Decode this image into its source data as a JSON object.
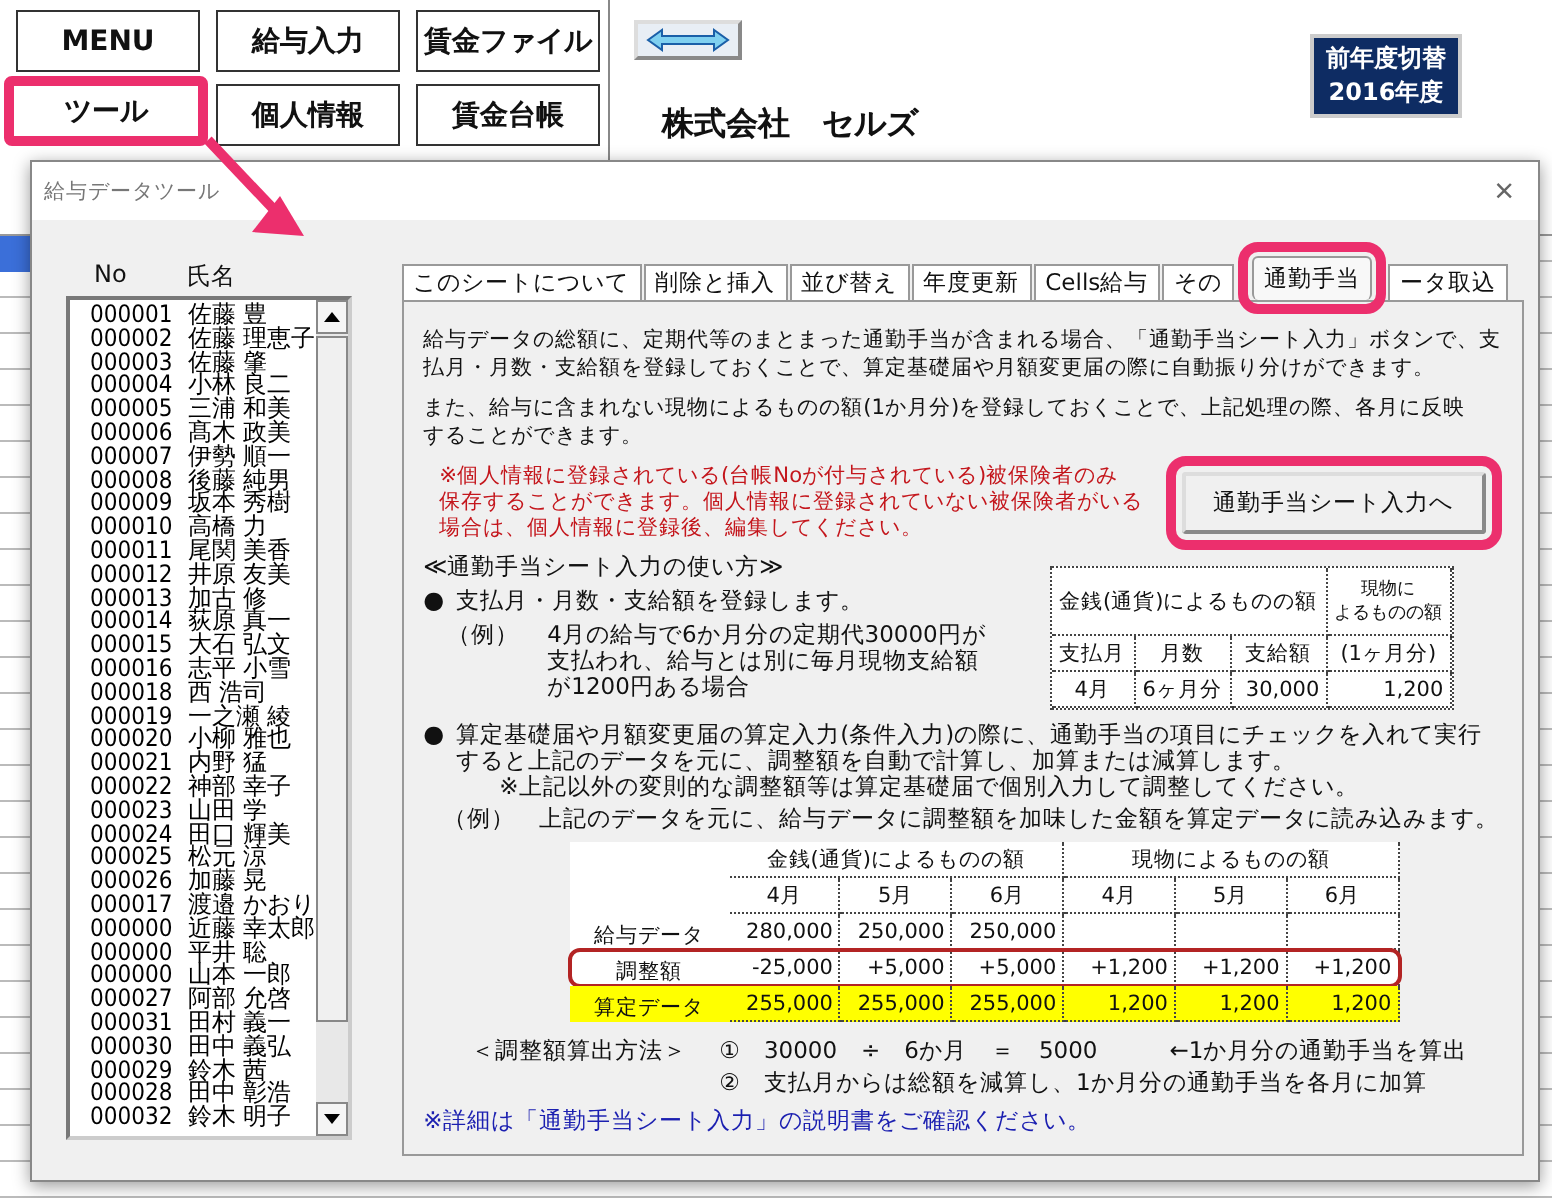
{
  "menu_buttons": [
    {
      "label": "MENU",
      "selected": false
    },
    {
      "label": "給与入力",
      "selected": false
    },
    {
      "label": "賃金ファイル",
      "selected": false
    },
    {
      "label": "ツール",
      "selected": true
    },
    {
      "label": "個人情報",
      "selected": false
    },
    {
      "label": "賃金台帳",
      "selected": false
    }
  ],
  "company": "株式会社　セルズ",
  "year_badge": [
    "前年度切替",
    "2016年度"
  ],
  "dialog": {
    "title": "給与データツール",
    "close": "×",
    "list_headers": [
      "No",
      "氏名"
    ],
    "employees": [
      {
        "no": "000001",
        "name": "佐藤 豊"
      },
      {
        "no": "000002",
        "name": "佐藤 理恵子"
      },
      {
        "no": "000003",
        "name": "佐藤 肇"
      },
      {
        "no": "000004",
        "name": "小林 良二"
      },
      {
        "no": "000005",
        "name": "三浦 和美"
      },
      {
        "no": "000006",
        "name": "髙木 政美"
      },
      {
        "no": "000007",
        "name": "伊勢 順一"
      },
      {
        "no": "000008",
        "name": "後藤 純男"
      },
      {
        "no": "000009",
        "name": "坂本 秀樹"
      },
      {
        "no": "000010",
        "name": "高橋 力"
      },
      {
        "no": "000011",
        "name": "尾関 美香"
      },
      {
        "no": "000012",
        "name": "井原 友美"
      },
      {
        "no": "000013",
        "name": "加古 修"
      },
      {
        "no": "000014",
        "name": "荻原 真一"
      },
      {
        "no": "000015",
        "name": "大石 弘文"
      },
      {
        "no": "000016",
        "name": "志平 小雪"
      },
      {
        "no": "000018",
        "name": "西 浩司"
      },
      {
        "no": "000019",
        "name": "一之瀬 綾"
      },
      {
        "no": "000020",
        "name": "小柳 雅也"
      },
      {
        "no": "000021",
        "name": "内野 猛"
      },
      {
        "no": "000022",
        "name": "神部 幸子"
      },
      {
        "no": "000023",
        "name": "山田 学"
      },
      {
        "no": "000024",
        "name": "田口 輝美"
      },
      {
        "no": "000025",
        "name": "松元 涼"
      },
      {
        "no": "000026",
        "name": "加藤 晃"
      },
      {
        "no": "000017",
        "name": "渡邉 かおり"
      },
      {
        "no": "000000",
        "name": "近藤 幸太郎"
      },
      {
        "no": "000000",
        "name": "平井 聡"
      },
      {
        "no": "000000",
        "name": "山本 一郎"
      },
      {
        "no": "000027",
        "name": "阿部 允啓"
      },
      {
        "no": "000031",
        "name": "田村 義一"
      },
      {
        "no": "000030",
        "name": "田中 義弘"
      },
      {
        "no": "000029",
        "name": "鈴木 茜"
      },
      {
        "no": "000028",
        "name": "田中 彰浩"
      },
      {
        "no": "000032",
        "name": "鈴木 明子"
      }
    ],
    "tabs": [
      {
        "label": "このシートについて",
        "selected": false
      },
      {
        "label": "削除と挿入",
        "selected": false
      },
      {
        "label": "並び替え",
        "selected": false
      },
      {
        "label": "年度更新",
        "selected": false
      },
      {
        "label": "Cells給与",
        "selected": false
      },
      {
        "label": "その",
        "selected": false
      },
      {
        "label": "通勤手当",
        "selected": true
      },
      {
        "label": "ータ取込",
        "selected": false
      }
    ],
    "intro": [
      [
        "給与データの総額に、定期代等のまとまった通勤手当が含まれる場合、「通勤手当シート入力」ボタンで、支",
        "払月・月数・支給額を登録しておくことで、算定基礎届や月額変更届の際に自動振り分けができます。"
      ],
      [
        "また、給与に含まれない現物によるものの額(1か月分)を登録しておくことで、上記処理の際、各月に反映",
        "することができます。"
      ]
    ],
    "note": [
      "※個人情報に登録されている(台帳Noが付与されている)被保険者のみ",
      "保存することができます。個人情報に登録されていない被保険者がいる",
      "場合は、個人情報に登録後、編集してください。"
    ],
    "input_button": {
      "label": "通勤手当シート入力へ",
      "highlighted": true
    },
    "howto_title": "≪通勤手当シート入力の使い方≫",
    "bullet": "●",
    "step1": "支払月・月数・支給額を登録します。",
    "example1_label": "（例）",
    "example1": [
      "4月の給与で6か月分の定期代30000円が",
      "支払われ、給与とは別に毎月現物支給額",
      "が1200円ある場合"
    ],
    "small_table": {
      "group_cash": "金銭(通貨)によるものの額",
      "group_kind": [
        "現物に",
        "よるものの額"
      ],
      "headers": [
        "支払月",
        "月数",
        "支給額",
        "(1ヶ月分)"
      ],
      "values": [
        "4月",
        "6ヶ月分",
        "30,000",
        "1,200"
      ]
    },
    "step2": [
      "算定基礎届や月額変更届の算定入力(条件入力)の際に、通勤手当の項目にチェックを入れて実行",
      "すると上記のデータを元に、調整額を自動で計算し、加算または減算します。"
    ],
    "step2_note": "※上記以外の変則的な調整額等は算定基礎届で個別入力して調整してください。",
    "example2_label": "（例）",
    "example2": "上記のデータを元に、給与データに調整額を加味した金額を算定データに読み込みます。",
    "calc_table": {
      "group_cash": "金銭(通貨)によるものの額",
      "group_kind": "現物によるものの額",
      "months": [
        "4月",
        "5月",
        "6月",
        "4月",
        "5月",
        "6月"
      ],
      "rows": [
        {
          "label": "給与データ",
          "kind": "plain",
          "highlighted": false,
          "values": [
            "280,000",
            "250,000",
            "250,000"
          ]
        },
        {
          "label": "調整額",
          "kind": "plain",
          "highlighted": true,
          "values": [
            "-25,000",
            "+5,000",
            "+5,000",
            "+1,200",
            "+1,200",
            "+1,200"
          ]
        },
        {
          "label": "算定データ",
          "kind": "result",
          "highlighted": false,
          "values": [
            "255,000",
            "255,000",
            "255,000",
            "1,200",
            "1,200",
            "1,200"
          ]
        }
      ]
    },
    "method_label": "＜調整額算出方法＞",
    "method_lines": [
      {
        "text": "①　30000　÷　6か月　＝　5000",
        "aside": "←1か月分の通勤手当を算出"
      },
      {
        "text": "②　支払月からは総額を減算し、1か月分の通勤手当を各月に加算"
      }
    ],
    "detail_note": "※詳細は「通勤手当シート入力」の説明書をご確認ください。"
  }
}
